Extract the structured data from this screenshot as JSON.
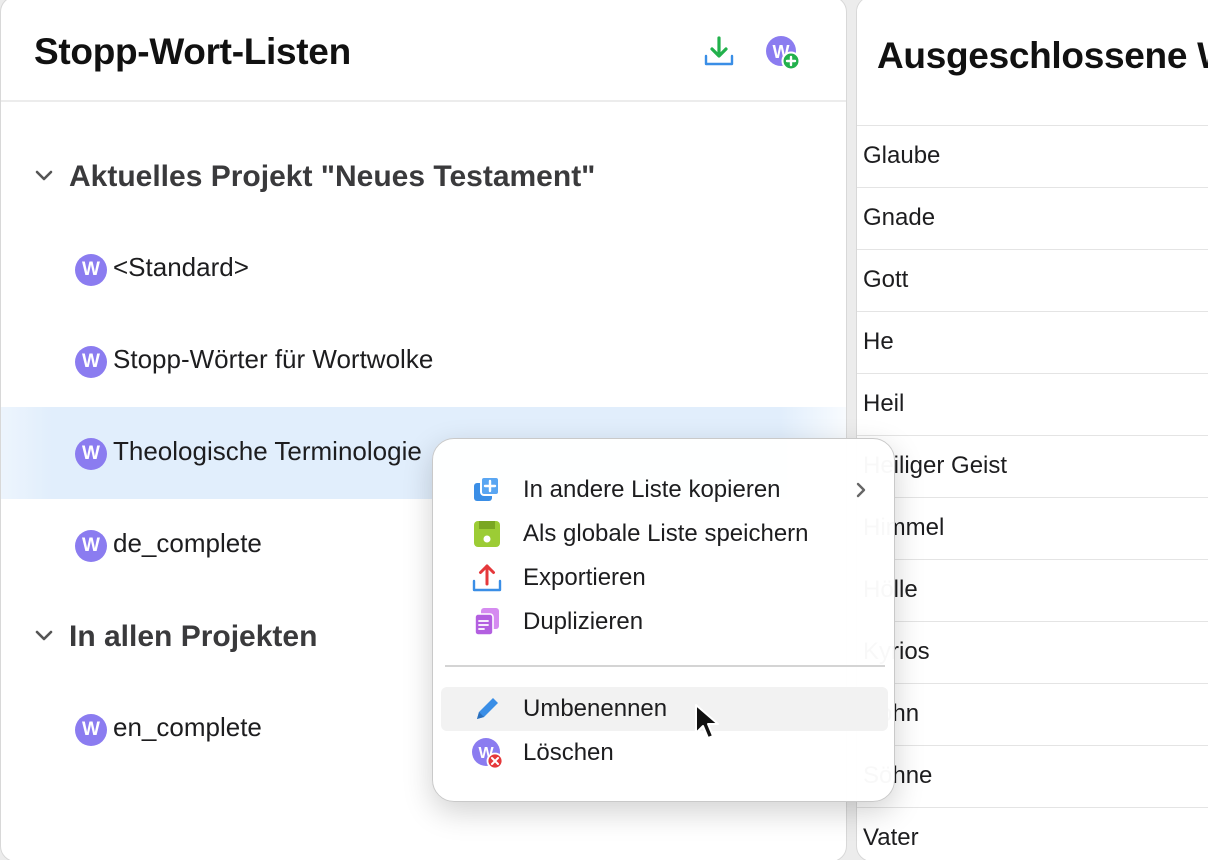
{
  "left_panel": {
    "title": "Stopp-Wort-Listen",
    "header_icons": [
      "download-icon",
      "add-list-icon"
    ],
    "groups": [
      {
        "label": "Aktuelles Projekt \"Neues Testament\"",
        "expanded": true,
        "items": [
          {
            "badge": "W",
            "label": "<Standard>"
          },
          {
            "badge": "W",
            "label": "Stopp-Wörter für Wortwolke"
          },
          {
            "badge": "W",
            "label": "Theologische Terminologie",
            "selected": true
          },
          {
            "badge": "W",
            "label": "de_complete"
          }
        ]
      },
      {
        "label": "In allen Projekten",
        "expanded": true,
        "items": [
          {
            "badge": "W",
            "label": "en_complete"
          }
        ]
      }
    ]
  },
  "right_panel": {
    "title": "Ausgeschlossene W",
    "words": [
      "Glaube",
      "Gnade",
      "Gott",
      "He",
      "Heil",
      "Heiliger Geist",
      "Himmel",
      "Hölle",
      "Kyrios",
      "Sohn",
      "Söhne",
      "Vater"
    ]
  },
  "context_menu": {
    "items": [
      {
        "label": "In andere Liste kopieren",
        "icon": "copy-to-list-icon",
        "submenu": true
      },
      {
        "label": "Als globale Liste speichern",
        "icon": "save-global-icon"
      },
      {
        "label": "Exportieren",
        "icon": "export-icon"
      },
      {
        "label": "Duplizieren",
        "icon": "duplicate-icon"
      },
      {
        "label": "Umbenennen",
        "icon": "pencil-icon",
        "hover": true
      },
      {
        "label": "Löschen",
        "icon": "delete-list-icon"
      }
    ]
  },
  "colors": {
    "badge": "#8b7cf0",
    "selection": "#e1eefc",
    "accent_blue": "#3a8ee6",
    "accent_green": "#22b14c",
    "accent_red": "#e5383b"
  }
}
